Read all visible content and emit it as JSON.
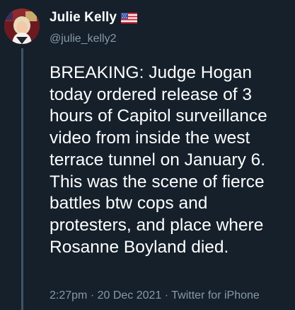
{
  "author": {
    "display_name": "Julie Kelly",
    "flag_icon": "us-flag-icon",
    "handle": "@julie_kelly2"
  },
  "tweet": {
    "text": "BREAKING: Judge Hogan\ntoday ordered release of 3\nhours of Capitol surveillance\nvideo from inside the west\nterrace tunnel on January 6.\nThis was the scene of fierce\nbattles btw cops and\nprotesters, and place where\nRosanne Boyland died.",
    "time": "2:27pm",
    "separator": "·",
    "date": "20 Dec 2021",
    "source": "Twitter for iPhone"
  },
  "colors": {
    "background": "#15202b",
    "primary_text": "#ffffff",
    "secondary_text": "#8899a6",
    "thread_line": "#3d5466"
  }
}
